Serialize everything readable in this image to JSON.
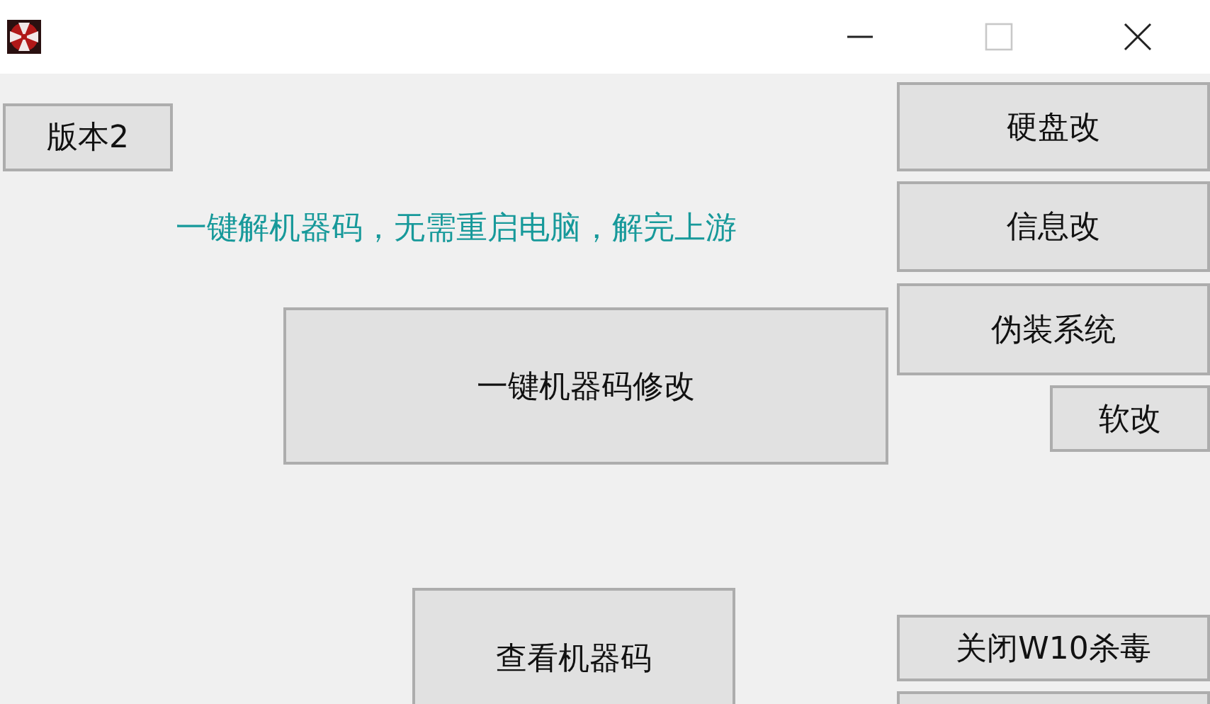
{
  "window": {
    "controls": [
      {
        "kind": "minimize",
        "disabled": false
      },
      {
        "kind": "maximize",
        "disabled": true
      },
      {
        "kind": "close",
        "disabled": false
      }
    ]
  },
  "notice": "一键解机器码，无需重启电脑，解完上游",
  "buttons": [
    {
      "label": "版本2"
    },
    {
      "label": "硬盘改"
    },
    {
      "label": "信息改"
    },
    {
      "label": "伪装系统"
    },
    {
      "label": "软改"
    },
    {
      "label": "一键机器码修改"
    },
    {
      "label": "查看机器码"
    },
    {
      "label": "关闭W10杀毒"
    }
  ]
}
